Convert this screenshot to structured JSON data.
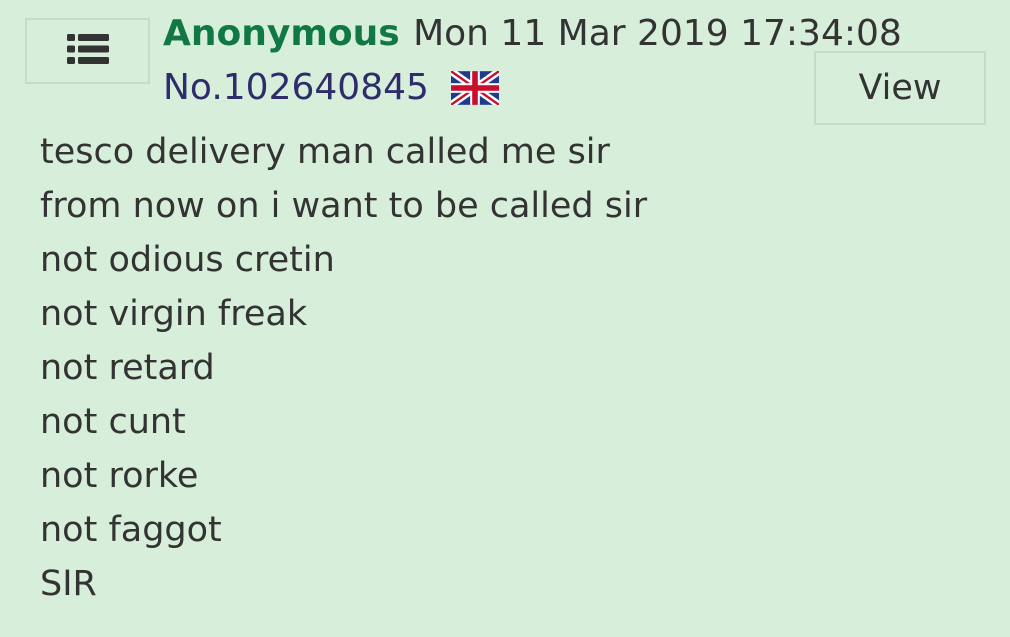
{
  "post": {
    "name": "Anonymous",
    "date": "Mon 11 Mar 2019 17:34:08",
    "number": "No.102640845",
    "flag_icon": "uk-flag-icon",
    "menu_icon": "list-menu-icon",
    "view_label": "View",
    "body_lines": [
      "tesco delivery man called me sir",
      "from now on i want to be called sir",
      "not odious cretin",
      "not virgin freak",
      "not retard",
      "not cunt",
      "not rorke",
      "not faggot",
      "SIR"
    ]
  },
  "colors": {
    "background": "#d7efda",
    "name": "#117743",
    "post_number": "#2f2c6b",
    "text": "#333333",
    "border": "#c5dcc7"
  }
}
